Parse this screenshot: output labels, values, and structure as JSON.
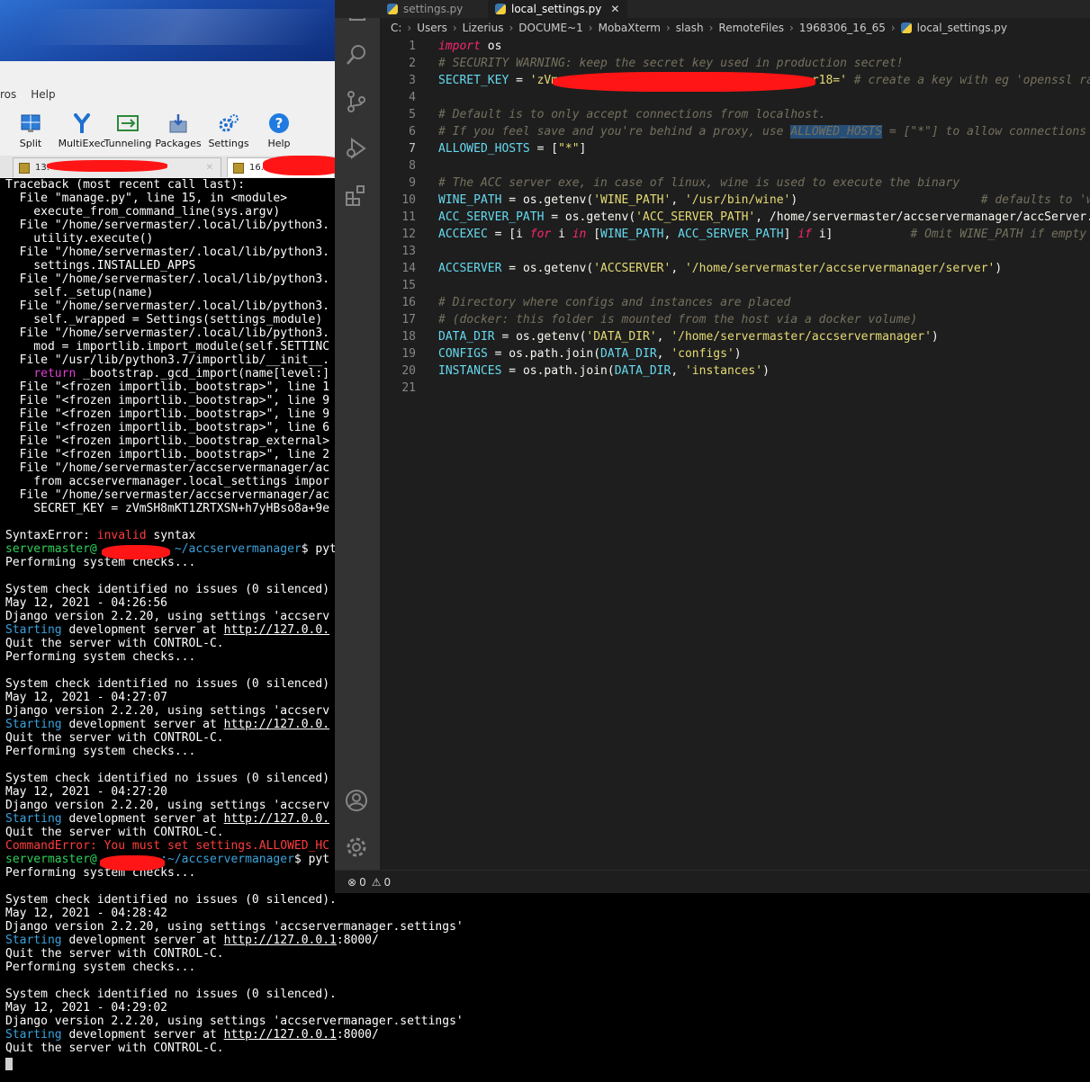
{
  "moba": {
    "menu": [
      "ros",
      "Help"
    ],
    "toolbar": [
      {
        "label": "Split",
        "icon": "split-icon"
      },
      {
        "label": "MultiExec",
        "icon": "multiexec-icon"
      },
      {
        "label": "Tunneling",
        "icon": "tunneling-icon"
      },
      {
        "label": "Packages",
        "icon": "packages-icon"
      },
      {
        "label": "Settings",
        "icon": "settings-icon"
      },
      {
        "label": "Help",
        "icon": "help-icon"
      }
    ],
    "tabs": [
      {
        "label": "13."
      },
      {
        "label": "16."
      }
    ],
    "tab_close": "✕"
  },
  "terminal": {
    "lines": [
      "Traceback (most recent call last):",
      "  File \"manage.py\", line 15, in <module>",
      "    execute_from_command_line(sys.argv)",
      "  File \"/home/servermaster/.local/lib/python3.",
      "    utility.execute()",
      "  File \"/home/servermaster/.local/lib/python3.",
      "    settings.INSTALLED_APPS",
      "  File \"/home/servermaster/.local/lib/python3.",
      "    self._setup(name)",
      "  File \"/home/servermaster/.local/lib/python3.",
      "    self._wrapped = Settings(settings_module)",
      "  File \"/home/servermaster/.local/lib/python3.",
      "    mod = importlib.import_module(self.SETTINC",
      "  File \"/usr/lib/python3.7/importlib/__init__.",
      "    return _bootstrap._gcd_import(name[level:]",
      "  File \"<frozen importlib._bootstrap>\", line 1",
      "  File \"<frozen importlib._bootstrap>\", line 9",
      "  File \"<frozen importlib._bootstrap>\", line 9",
      "  File \"<frozen importlib._bootstrap>\", line 6",
      "  File \"<frozen importlib._bootstrap_external>",
      "  File \"<frozen importlib._bootstrap>\", line 2",
      "  File \"/home/servermaster/accservermanager/ac",
      "    from accservermanager.local_settings impor",
      "  File \"/home/servermaster/accservermanager/ac",
      "    SECRET_KEY = zVmSH8mKT1ZRTXSN+h7yHBso8a+9e",
      "",
      "SyntaxError: invalid syntax",
      "servermaster@           ~/accservermanager$ pyt",
      "Performing system checks...",
      "",
      "System check identified no issues (0 silenced)",
      "May 12, 2021 - 04:26:56",
      "Django version 2.2.20, using settings 'accserv",
      "Starting development server at http://127.0.0.",
      "Quit the server with CONTROL-C.",
      "Performing system checks...",
      "",
      "System check identified no issues (0 silenced)",
      "May 12, 2021 - 04:27:07",
      "Django version 2.2.20, using settings 'accserv",
      "Starting development server at http://127.0.0.",
      "Quit the server with CONTROL-C.",
      "Performing system checks...",
      "",
      "System check identified no issues (0 silenced)",
      "May 12, 2021 - 04:27:20",
      "Django version 2.2.20, using settings 'accserv",
      "Starting development server at http://127.0.0.",
      "Quit the server with CONTROL-C.",
      "CommandError: You must set settings.ALLOWED_HC",
      "servermaster@         :~/accservermanager$ pyt",
      "Performing system checks...",
      "",
      "System check identified no issues (0 silenced).",
      "May 12, 2021 - 04:28:42",
      "Django version 2.2.20, using settings 'accservermanager.settings'",
      "Starting development server at http://127.0.0.1:8000/",
      "Quit the server with CONTROL-C.",
      "Performing system checks...",
      "",
      "System check identified no issues (0 silenced).",
      "May 12, 2021 - 04:29:02",
      "Django version 2.2.20, using settings 'accservermanager.settings'",
      "Starting development server at http://127.0.0.1:8000/",
      "Quit the server with CONTROL-C."
    ]
  },
  "vscode": {
    "tabs": [
      {
        "label": "settings.py",
        "active": false
      },
      {
        "label": "local_settings.py",
        "active": true
      }
    ],
    "tab_close": "✕",
    "breadcrumbs": [
      "C:",
      "Users",
      "Lizerius",
      "DOCUME~1",
      "MobaXterm",
      "slash",
      "RemoteFiles",
      "1968306_16_65",
      "local_settings.py"
    ],
    "code": [
      "import os",
      "# SECURITY WARNING: keep the secret key used in production secret!",
      "SECRET_KEY = 'zVm                                    r18=' # create a key with eg 'openssl ra",
      "",
      "# Default is to only accept connections from localhost.",
      "# If you feel save and you're behind a proxy, use ALLOWED_HOSTS = [\"*\"] to allow connections f",
      "ALLOWED_HOSTS = [\"*\"]",
      "",
      "# The ACC server exe, in case of linux, wine is used to execute the binary",
      "WINE_PATH = os.getenv('WINE_PATH', '/usr/bin/wine')                          # defaults to 'wi",
      "ACC_SERVER_PATH = os.getenv('ACC_SERVER_PATH', '/home/servermaster/accservermanager/accServer.",
      "ACCEXEC = [i for i in [WINE_PATH, ACC_SERVER_PATH] if i]           # Omit WINE_PATH if empty",
      "",
      "ACCSERVER = os.getenv('ACCSERVER', '/home/servermaster/accservermanager/server')",
      "",
      "# Directory where configs and instances are placed",
      "# (docker: this folder is mounted from the host via a docker volume)",
      "DATA_DIR = os.getenv('DATA_DIR', '/home/servermaster/accservermanager')",
      "CONFIGS = os.path.join(DATA_DIR, 'configs')",
      "INSTANCES = os.path.join(DATA_DIR, 'instances')",
      ""
    ],
    "line_numbers": [
      "1",
      "2",
      "3",
      "4",
      "5",
      "6",
      "7",
      "8",
      "9",
      "10",
      "11",
      "12",
      "13",
      "14",
      "15",
      "16",
      "17",
      "18",
      "19",
      "20",
      "21"
    ],
    "current_line": 7,
    "status": {
      "errors": "0",
      "warnings": "0"
    }
  }
}
